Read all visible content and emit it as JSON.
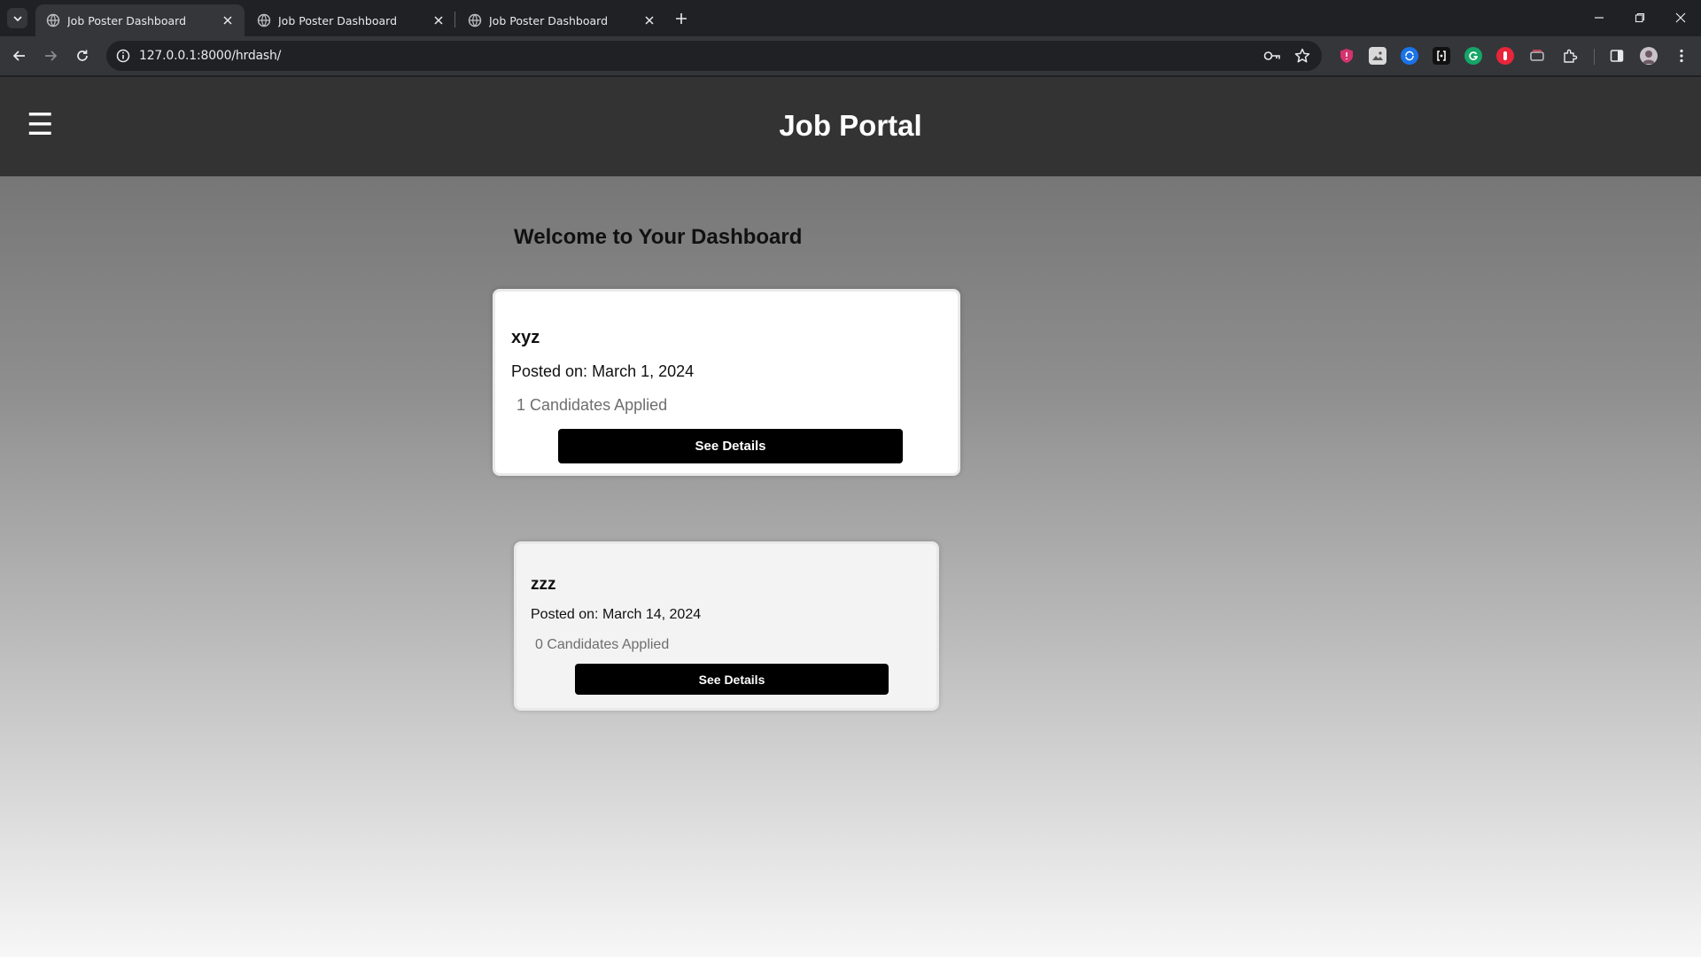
{
  "browser": {
    "tabs": [
      {
        "title": "Job Poster Dashboard",
        "active": true
      },
      {
        "title": "Job Poster Dashboard",
        "active": false
      },
      {
        "title": "Job Poster Dashboard",
        "active": false
      }
    ],
    "url": "127.0.0.1:8000/hrdash/",
    "icons": [
      "tab-list-icon",
      "globe-icon",
      "close-icon",
      "new-tab-icon",
      "minimize-icon",
      "restore-icon",
      "window-close-icon",
      "back-icon",
      "forward-icon",
      "reload-icon",
      "site-info-icon",
      "password-key-icon",
      "bookmark-star-icon",
      "extensions-icon",
      "side-panel-icon",
      "profile-avatar-icon",
      "menu-dots-icon"
    ]
  },
  "header": {
    "menu_icon": "☰",
    "title": "Job Portal"
  },
  "main": {
    "heading": "Welcome to Your Dashboard",
    "jobs": [
      {
        "title": "xyz",
        "posted": "Posted on: March 1, 2024",
        "applicants": "1 Candidates Applied",
        "button": "See Details"
      },
      {
        "title": "zzz",
        "posted": "Posted on: March 14, 2024",
        "applicants": "0 Candidates Applied",
        "button": "See Details"
      }
    ]
  },
  "colors": {
    "header_bg": "#333333",
    "button_bg": "#000000",
    "chrome_bg": "#202124",
    "toolbar_bg": "#35363a"
  }
}
